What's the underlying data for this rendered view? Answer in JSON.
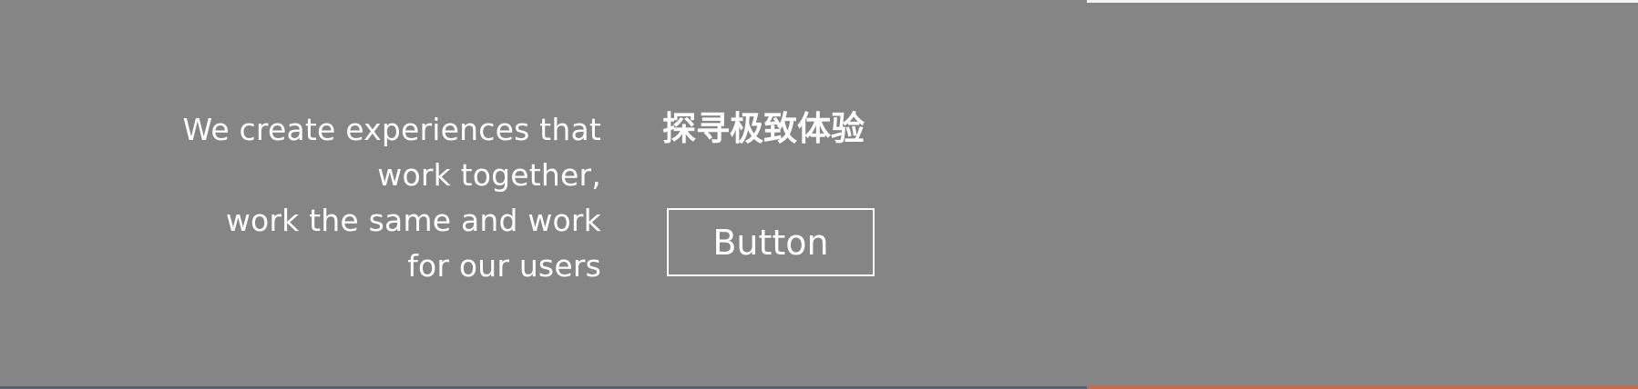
{
  "hero": {
    "tagline_lines": [
      "We create experiences that",
      "work together,",
      "work the same and work",
      "for our users"
    ],
    "slogan": "探寻极致体验",
    "button_label": "Button"
  },
  "colors": {
    "background": "#858585",
    "text": "#ffffff",
    "button_border": "#ffffff",
    "accent_bottom_strip": "#c56d49"
  }
}
